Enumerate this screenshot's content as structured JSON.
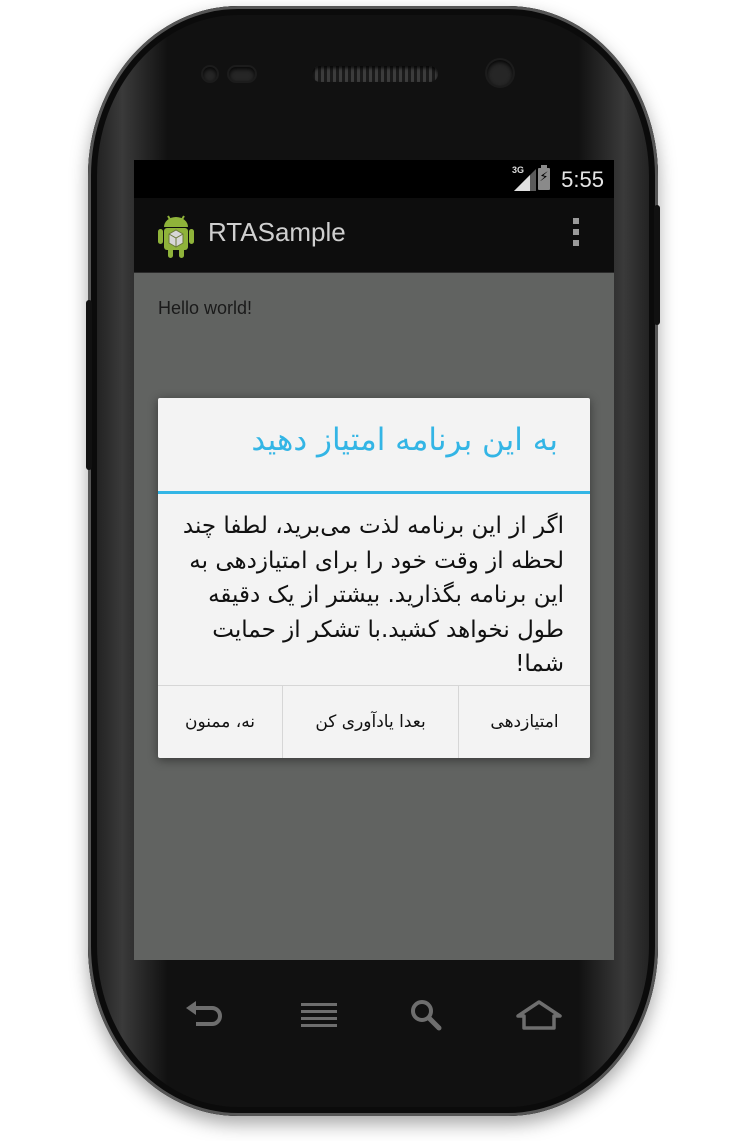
{
  "status_bar": {
    "network_type": "3G",
    "time": "5:55",
    "icons": [
      "signal-icon",
      "battery-charging-icon"
    ]
  },
  "action_bar": {
    "app_icon": "android-icon",
    "title": "RTASample",
    "overflow_icon": "overflow-menu-icon"
  },
  "content": {
    "text": "Hello world!"
  },
  "dialog": {
    "title": "به این برنامه امتیاز دهید",
    "message": "اگر از این برنامه لذت می‌برید، لطفا چند لحظه از وقت خود را برای امتیازدهی به این برنامه بگذارید. بیشتر از یک دقیقه طول نخواهد کشید.با تشکر از حمایت شما!",
    "accent_color": "#33b5e5",
    "buttons": {
      "rate": "امتیازدهی",
      "later": "بعدا یادآوری کن",
      "no_thanks": "نه، ممنون"
    }
  },
  "nav_bar": {
    "icons": [
      "back-icon",
      "menu-icon",
      "search-icon",
      "home-icon"
    ]
  }
}
